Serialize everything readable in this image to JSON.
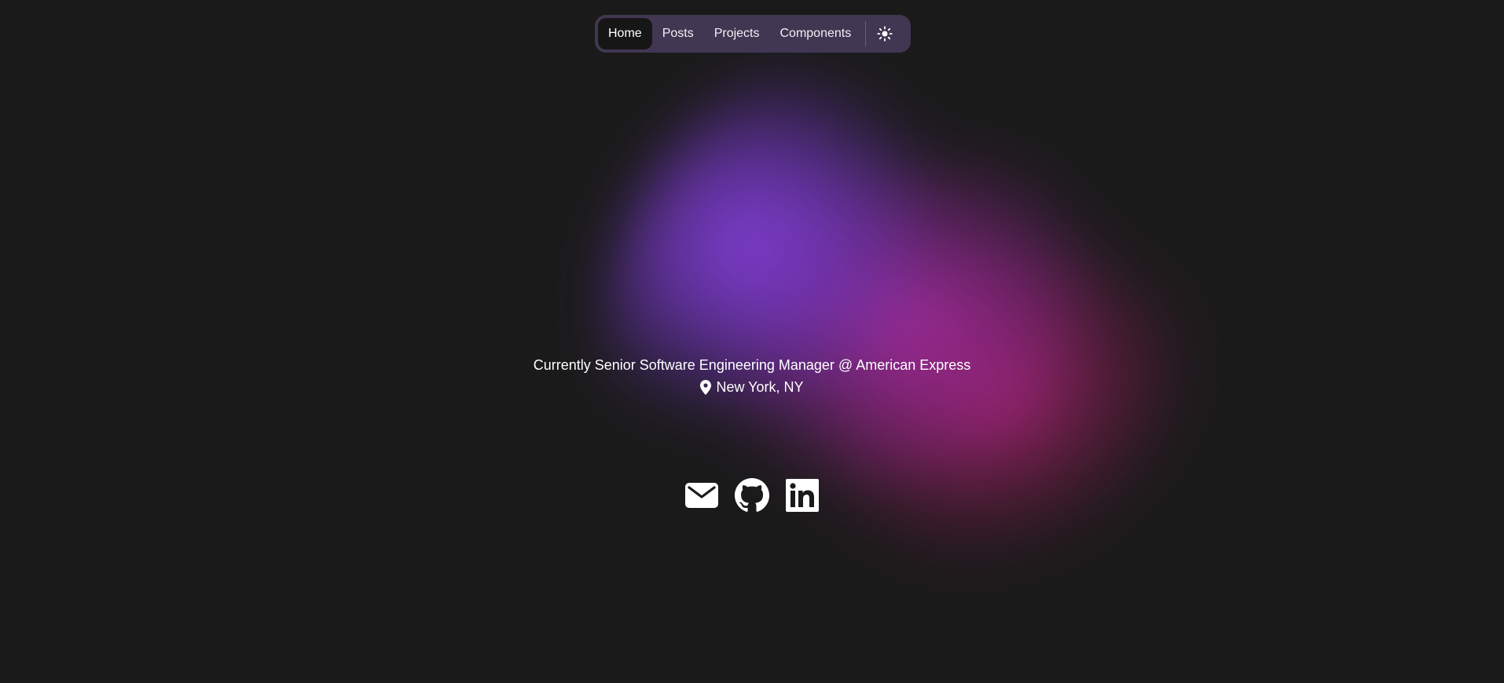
{
  "theme": {
    "background": "#1a1a1a",
    "nav_background": "#504268",
    "active_tab_background": "#161616",
    "glow_colors": [
      "#8640dc",
      "#b02eaa",
      "#be2478"
    ]
  },
  "nav": {
    "items": [
      {
        "label": "Home",
        "active": true
      },
      {
        "label": "Posts",
        "active": false
      },
      {
        "label": "Projects",
        "active": false
      },
      {
        "label": "Components",
        "active": false
      }
    ],
    "theme_toggle_icon": "sun-icon"
  },
  "profile": {
    "tagline": "Currently Senior Software Engineering Manager @ American Express",
    "location": "New York, NY",
    "location_icon": "map-pin-icon"
  },
  "socials": [
    {
      "name": "email",
      "icon": "mail-icon"
    },
    {
      "name": "github",
      "icon": "github-icon"
    },
    {
      "name": "linkedin",
      "icon": "linkedin-icon"
    }
  ]
}
